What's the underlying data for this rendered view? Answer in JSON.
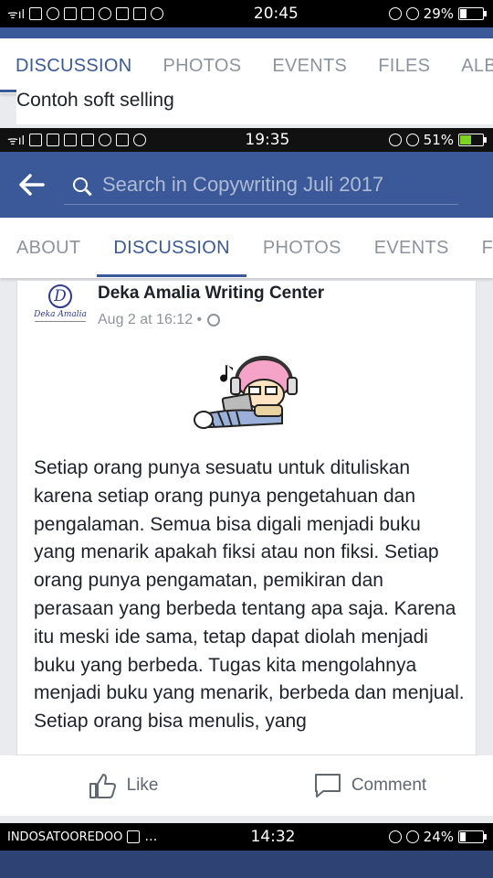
{
  "status_bar_1": {
    "carrier": "ᯤıl",
    "time": "20:45",
    "battery": "29%",
    "battery_level": 0.29
  },
  "group_1": {
    "tabs": [
      "DISCUSSION",
      "PHOTOS",
      "EVENTS",
      "FILES",
      "ALBU"
    ],
    "active_tab": "DISCUSSION",
    "previous_post_title": "Contoh soft selling"
  },
  "status_bar_2": {
    "carrier": "ᯤıl",
    "time": "19:35",
    "battery": "51%",
    "battery_level": 0.51
  },
  "header": {
    "search_placeholder": "Search in Copywriting Juli 2017"
  },
  "group_2": {
    "tabs": [
      "ABOUT",
      "DISCUSSION",
      "PHOTOS",
      "EVENTS",
      "FIL"
    ],
    "active_tab": "DISCUSSION"
  },
  "post": {
    "page_name": "Deka Amalia Writing Center",
    "date": "Aug 2 at 16:12 •",
    "avatar_letter": "D",
    "avatar_signature": "Deka Amalia",
    "body": "Setiap orang punya sesuatu untuk dituliskan karena setiap orang punya pengetahuan dan pengalaman. Semua bisa digali menjadi buku yang menarik apakah fiksi atau non fiksi. Setiap orang punya pengamatan, pemikiran dan perasaan yang berbeda tentang apa saja. Karena itu meski ide sama, tetap dapat diolah menjadi buku yang berbeda. Tugas kita mengolahnya menjadi buku yang menarik, berbeda dan menjual. Setiap orang bisa menulis, yang"
  },
  "actions": {
    "like_label": "Like",
    "comment_label": "Comment"
  },
  "status_bar_3": {
    "carrier": "INDOSATOOREDOO",
    "extra": "…",
    "time": "14:32",
    "battery": "24%",
    "battery_level": 0.24
  },
  "colors": {
    "brand": "#3b5998",
    "active_tab": "#3b5998",
    "inactive_tab": "#8d949e",
    "battery_fill": "#7ed321"
  }
}
